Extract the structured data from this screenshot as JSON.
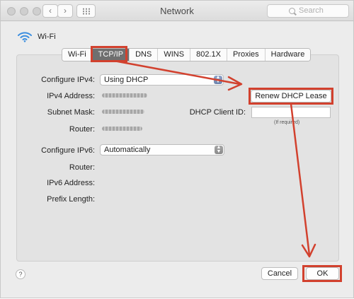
{
  "window": {
    "title": "Network"
  },
  "search": {
    "placeholder": "Search"
  },
  "wifi": {
    "label": "Wi-Fi"
  },
  "tabs": [
    {
      "label": "Wi-Fi",
      "active": false
    },
    {
      "label": "TCP/IP",
      "active": true
    },
    {
      "label": "DNS",
      "active": false
    },
    {
      "label": "WINS",
      "active": false
    },
    {
      "label": "802.1X",
      "active": false
    },
    {
      "label": "Proxies",
      "active": false
    },
    {
      "label": "Hardware",
      "active": false
    }
  ],
  "ipv4": {
    "configure_label": "Configure IPv4:",
    "configure_value": "Using DHCP",
    "address_label": "IPv4 Address:",
    "subnet_label": "Subnet Mask:",
    "router_label": "Router:",
    "renew_button": "Renew DHCP Lease",
    "client_id_label": "DHCP Client ID:",
    "client_id_value": "",
    "client_id_hint": "(If required)"
  },
  "ipv6": {
    "configure_label": "Configure IPv6:",
    "configure_value": "Automatically",
    "router_label": "Router:",
    "address_label": "IPv6 Address:",
    "prefix_label": "Prefix Length:"
  },
  "footer": {
    "help": "?",
    "cancel": "Cancel",
    "ok": "OK"
  },
  "colors": {
    "annotation": "#d2412e",
    "active_tab": "#6f6f6f",
    "stepper_blue": "#7d92b9"
  },
  "icons": {
    "back": "chevron-left-icon",
    "forward": "chevron-right-icon",
    "grid": "grid-icon",
    "search": "search-icon",
    "wifi": "wifi-icon"
  }
}
